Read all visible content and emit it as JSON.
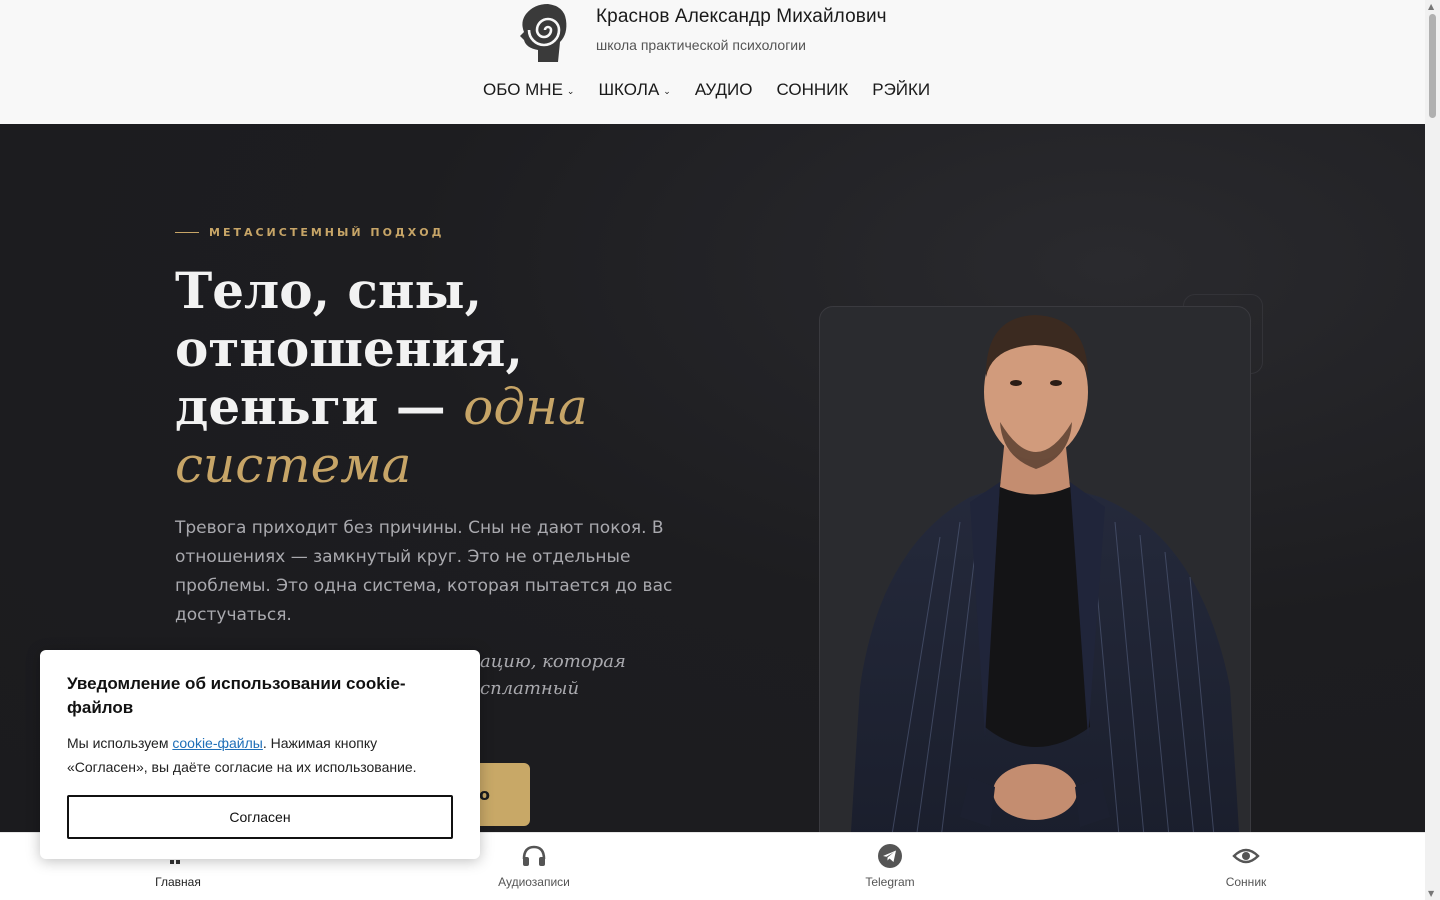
{
  "header": {
    "title": "Краснов Александр Михайлович",
    "subtitle": "школа практической психологии",
    "nav": [
      {
        "label": "ОБО МНЕ",
        "has_dropdown": true
      },
      {
        "label": "ШКОЛА",
        "has_dropdown": true
      },
      {
        "label": "АУДИО",
        "has_dropdown": false
      },
      {
        "label": "СОННИК",
        "has_dropdown": false
      },
      {
        "label": "РЭЙКИ",
        "has_dropdown": false
      }
    ]
  },
  "hero": {
    "eyebrow": "МЕТАСИСТЕМНЫЙ ПОДХОД",
    "headline_plain": "Тело, сны, отношения, деньги — ",
    "headline_accent": "одна система",
    "lead": "Тревога приходит без причины. Сны не дают покоя. В отношениях — замкнутый круг. Это не отдельные проблемы. Это одна система, которая пытается до вас достучаться.",
    "lead2_visible": "ацию, которая\nсплатный",
    "cta_visible": "о"
  },
  "cookie": {
    "title": "Уведомление об использовании cookie-файлов",
    "text_before": "Мы используем ",
    "link": "cookie-файлы",
    "text_after": ". Нажимая кнопку «Согласен», вы даёте согласие на их использование.",
    "button": "Согласен"
  },
  "bottom_nav": [
    {
      "label": "Главная",
      "icon": "home-icon",
      "active": true
    },
    {
      "label": "Аудиозаписи",
      "icon": "headphones-icon",
      "active": false
    },
    {
      "label": "Telegram",
      "icon": "telegram-icon",
      "active": false
    },
    {
      "label": "Сонник",
      "icon": "eye-icon",
      "active": false
    }
  ],
  "colors": {
    "accent": "#c7a567",
    "hero_bg": "#1c1c1f",
    "header_bg": "#f8f8f8"
  }
}
